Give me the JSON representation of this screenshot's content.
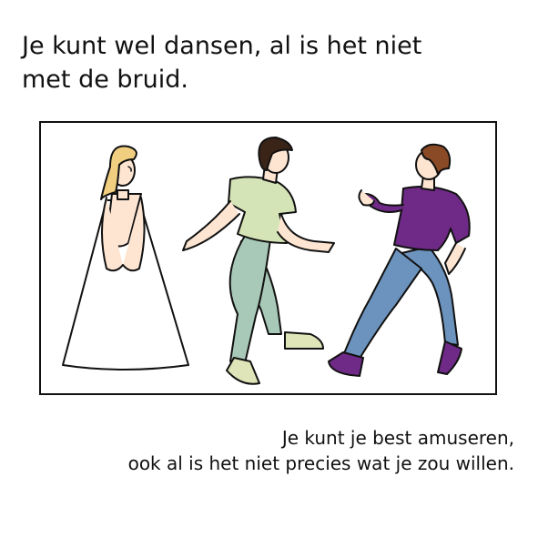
{
  "title": {
    "line1": "Je kunt wel dansen, al is het niet",
    "line2": "met de bruid."
  },
  "illustration": {
    "figures": [
      "bride-figure",
      "dancer-green-shirt-figure",
      "dancer-purple-shirt-figure"
    ],
    "colors": {
      "outline": "#111111",
      "skin": "#fde5d2",
      "bride_hair": "#f0cf80",
      "dancer_hair": "#3a2418",
      "dancer2_hair": "#8a4a25",
      "green_shirt": "#d5e4b6",
      "green_pants": "#a8c9b8",
      "green_shoes": "#dfe5b8",
      "purple_shirt": "#6e2a86",
      "blue_pants": "#6c93bd",
      "purple_shoes": "#6e2a86",
      "dress": "#ffffff"
    }
  },
  "caption": {
    "line1": "Je kunt je best amuseren,",
    "line2": "ook al is het niet precies wat je zou willen."
  }
}
